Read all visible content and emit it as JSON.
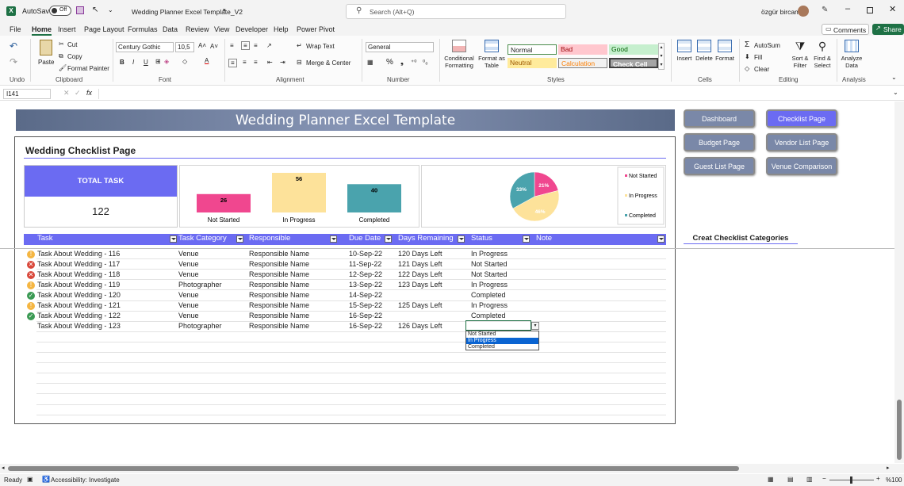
{
  "titlebar": {
    "autosave_label": "AutoSave",
    "autosave_state": "Off",
    "doc_title": "Wedding Planner Excel Template_V2",
    "search_placeholder": "Search (Alt+Q)",
    "user_name": "özgür bircan"
  },
  "menu": {
    "tabs": [
      "File",
      "Home",
      "Insert",
      "Page Layout",
      "Formulas",
      "Data",
      "Review",
      "View",
      "Developer",
      "Help",
      "Power Pivot"
    ],
    "comments_label": "Comments",
    "share_label": "Share"
  },
  "ribbon": {
    "clipboard": {
      "label": "Clipboard",
      "paste": "Paste",
      "cut": "Cut",
      "copy": "Copy",
      "format_painter": "Format Painter"
    },
    "undo_label": "Undo",
    "font": {
      "label": "Font",
      "name": "Century Gothic",
      "size": "10,5",
      "bold": "B",
      "italic": "I",
      "underline": "U"
    },
    "alignment": {
      "label": "Alignment",
      "wrap_text": "Wrap Text",
      "merge_center": "Merge & Center"
    },
    "number": {
      "label": "Number",
      "format": "General"
    },
    "styles": {
      "label": "Styles",
      "conditional_formatting": "Conditional Formatting",
      "format_as_table": "Format as Table",
      "normal": "Normal",
      "bad": "Bad",
      "good": "Good",
      "neutral": "Neutral",
      "calculation": "Calculation",
      "check_cell": "Check Cell"
    },
    "cells": {
      "label": "Cells",
      "insert": "Insert",
      "delete": "Delete",
      "format": "Format"
    },
    "editing": {
      "label": "Editing",
      "autosum": "AutoSum",
      "fill": "Fill",
      "clear": "Clear",
      "sort_filter": "Sort & Filter",
      "find_select": "Find & Select"
    },
    "analysis": {
      "label": "Analysis",
      "analyze_data": "Analyze Data"
    }
  },
  "formula_bar": {
    "name_box": "I141",
    "fx": "fx",
    "content": ""
  },
  "sheet": {
    "banner_title": "Wedding Planner Excel Template",
    "page_title": "Wedding Checklist Page",
    "nav_buttons": {
      "dashboard": "Dashboard",
      "checklist": "Checklist Page",
      "budget": "Budget Page",
      "vendor_list": "Vendor List Page",
      "guest_list": "Guest List Page",
      "venue_comparison": "Venue Comparison"
    },
    "create_categories": "Creat Checklist Categories",
    "total_task_label": "TOTAL TASK",
    "total_task_value": "122",
    "headers": [
      "Task",
      "Task Category",
      "Responsible",
      "Due Date",
      "Days Remaining",
      "Status",
      "Note"
    ],
    "rows": [
      {
        "task": "Task About Wedding - 116",
        "category": "Venue",
        "responsible": "Responsible Name",
        "due": "10-Sep-22",
        "remaining": "120 Days Left",
        "status": "In Progress",
        "icon": "progress"
      },
      {
        "task": "Task About Wedding - 117",
        "category": "Venue",
        "responsible": "Responsible Name",
        "due": "11-Sep-22",
        "remaining": "121 Days Left",
        "status": "Not Started",
        "icon": "notstarted"
      },
      {
        "task": "Task About Wedding - 118",
        "category": "Venue",
        "responsible": "Responsible Name",
        "due": "12-Sep-22",
        "remaining": "122 Days Left",
        "status": "Not Started",
        "icon": "notstarted"
      },
      {
        "task": "Task About Wedding - 119",
        "category": "Photographer",
        "responsible": "Responsible Name",
        "due": "13-Sep-22",
        "remaining": "123 Days Left",
        "status": "In Progress",
        "icon": "progress"
      },
      {
        "task": "Task About Wedding - 120",
        "category": "Venue",
        "responsible": "Responsible Name",
        "due": "14-Sep-22",
        "remaining": "",
        "status": "Completed",
        "icon": "completed"
      },
      {
        "task": "Task About Wedding - 121",
        "category": "Venue",
        "responsible": "Responsible Name",
        "due": "15-Sep-22",
        "remaining": "125 Days Left",
        "status": "In Progress",
        "icon": "progress"
      },
      {
        "task": "Task About Wedding - 122",
        "category": "Venue",
        "responsible": "Responsible Name",
        "due": "16-Sep-22",
        "remaining": "",
        "status": "Completed",
        "icon": "completed"
      },
      {
        "task": "Task About Wedding - 123",
        "category": "Photographer",
        "responsible": "Responsible Name",
        "due": "16-Sep-22",
        "remaining": "126 Days Left",
        "status": "",
        "icon": ""
      }
    ],
    "dropdown_options": [
      "Not Started",
      "In Progress",
      "Completed"
    ],
    "dropdown_selected": "In Progress"
  },
  "chart_data": [
    {
      "type": "bar",
      "categories": [
        "Not Started",
        "In Progress",
        "Completed"
      ],
      "values": [
        26,
        56,
        40
      ],
      "colors": [
        "#f0478f",
        "#fde29a",
        "#4aa3ad"
      ]
    },
    {
      "type": "pie",
      "categories": [
        "Not Started",
        "In Progress",
        "Completed"
      ],
      "values": [
        21,
        46,
        33
      ],
      "labels": [
        "21%",
        "46%",
        "33%"
      ],
      "colors": [
        "#f0478f",
        "#fde29a",
        "#4aa3ad"
      ],
      "legend": [
        "Not Started",
        "In Progress",
        "Completed"
      ],
      "legend_position": "right"
    }
  ],
  "statusbar": {
    "ready": "Ready",
    "accessibility": "Accessibility: Investigate",
    "zoom": "%100"
  },
  "colors": {
    "accent_purple": "#6b6bf2",
    "header_purple": "#6b6bf2",
    "excel_green": "#1e7145"
  }
}
